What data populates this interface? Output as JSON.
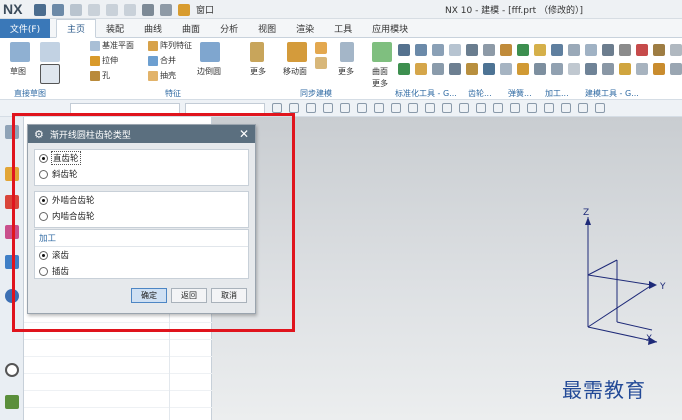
{
  "app": {
    "logo": "NX",
    "title": "NX 10 - 建模 - [fff.prt （修改的）]",
    "window_menu": "窗口"
  },
  "menu": {
    "file": "文件(F)",
    "tabs": [
      "主页",
      "装配",
      "曲线",
      "曲面",
      "分析",
      "视图",
      "渲染",
      "工具",
      "应用模块"
    ]
  },
  "ribbon": {
    "sketch": "草图",
    "datum_plane": "基准平面",
    "array_feature": "阵列特征",
    "extrude": "拉伸",
    "unite": "合并",
    "hole": "孔",
    "shell": "抽壳",
    "edge_blend": "边倒圆",
    "more1": "更多",
    "move_face": "移动面",
    "more2": "更多",
    "surface": "曲面",
    "more3": "更多",
    "groups": {
      "direct_sketch": "直接草图",
      "feature": "特征",
      "sync_modeling": "同步建模",
      "standard_tools": "标准化工具 - G...",
      "gear": "齿轮...",
      "spring": "弹簧...",
      "machining": "加工...",
      "building": "建模工具 - G..."
    }
  },
  "dialog": {
    "title": "渐开线圆柱齿轮类型",
    "group1": [
      {
        "label": "直齿轮",
        "selected": true
      },
      {
        "label": "斜齿轮",
        "selected": false
      }
    ],
    "group2": [
      {
        "label": "外啮合齿轮",
        "selected": true
      },
      {
        "label": "内啮合齿轮",
        "selected": false
      }
    ],
    "group3_title": "加工",
    "group3": [
      {
        "label": "滚齿",
        "selected": true
      },
      {
        "label": "插齿",
        "selected": false
      }
    ],
    "buttons": {
      "ok": "确定",
      "back": "返回",
      "cancel": "取消"
    }
  },
  "axes": {
    "z": "Z",
    "y": "Y",
    "x": "X"
  },
  "watermark": "最需教育",
  "colors": {
    "accent": "#3a78b8",
    "highlight": "#e0141d",
    "dialog_header": "#5b6f7f"
  }
}
